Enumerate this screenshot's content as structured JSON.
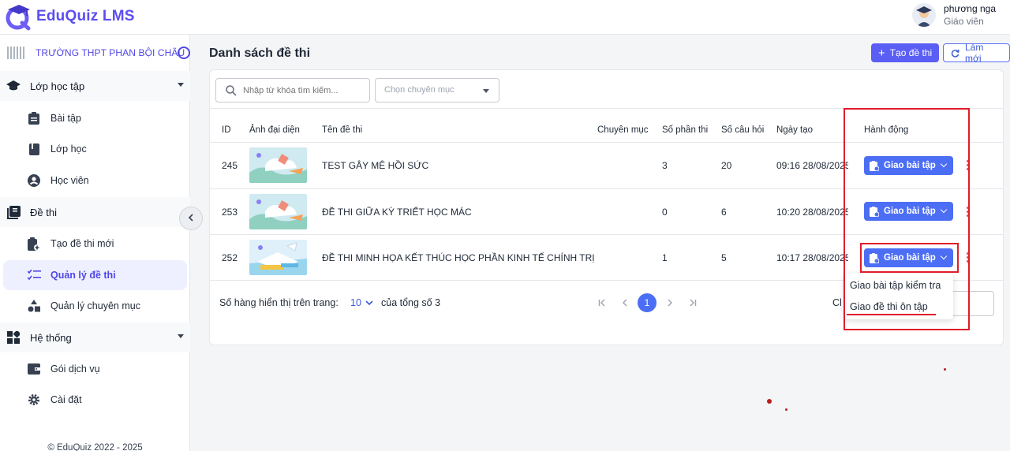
{
  "app": {
    "title": "EduQuiz LMS"
  },
  "user": {
    "name": "phương nga",
    "role": "Giáo viên"
  },
  "sidebar": {
    "school_name": "TRƯỜNG THPT PHAN BỘI CHÂU",
    "groups": [
      {
        "label": "Lớp học tập",
        "items": [
          "Bài tập",
          "Lớp học",
          "Học viên"
        ]
      },
      {
        "label": "Đề thi",
        "items": [
          "Tạo đề thi mới",
          "Quản lý đề thi",
          "Quản lý chuyên mục"
        ]
      },
      {
        "label": "Hệ thống",
        "items": [
          "Gói dịch vụ",
          "Cài đặt"
        ]
      }
    ],
    "active_item": "Quản lý đề thi",
    "footer": "© EduQuiz 2022 - 2025"
  },
  "page": {
    "title": "Danh sách đề thi",
    "create_label": "Tạo đề thi",
    "refresh_label": "Làm mới"
  },
  "filters": {
    "search_placeholder": "Nhập từ khóa tìm kiếm...",
    "category_placeholder": "Chọn chuyên mục"
  },
  "table": {
    "headers": [
      "ID",
      "Ảnh đại diện",
      "Tên đề thi",
      "Chuyên mục",
      "Số phần thi",
      "Số câu hỏi",
      "Ngày tạo",
      "Hành động"
    ],
    "rows": [
      {
        "id": "245",
        "name": "TEST GÂY MÊ HỒI SỨC",
        "category": "",
        "sections": "3",
        "questions": "20",
        "created": "09:16 28/08/2025",
        "action": "Giao bài tập"
      },
      {
        "id": "253",
        "name": "ĐỀ THI GIỮA KỲ TRIẾT HỌC MÁC",
        "category": "",
        "sections": "0",
        "questions": "6",
        "created": "10:20 28/08/2025",
        "action": "Giao bài tập"
      },
      {
        "id": "252",
        "name": "ĐỀ THI MINH HỌA KẾT THÚC HỌC PHẦN KINH TẾ CHÍNH TRỊ",
        "category": "",
        "sections": "1",
        "questions": "5",
        "created": "10:17 28/08/2025",
        "action": "Giao bài tập"
      }
    ]
  },
  "pagination": {
    "rows_label": "Số hàng hiển thị trên trang:",
    "rows_value": "10",
    "total_label": "của tổng số 3",
    "current_page": "1",
    "goto_label_partial": "Cl"
  },
  "dropdown": {
    "items": [
      "Giao bài tập kiểm tra",
      "Giao đề thi ôn tập"
    ]
  },
  "colors": {
    "brand": "#5b4ef0",
    "primary_button": "#4c6ef5",
    "annotation": "#e11d2a"
  }
}
